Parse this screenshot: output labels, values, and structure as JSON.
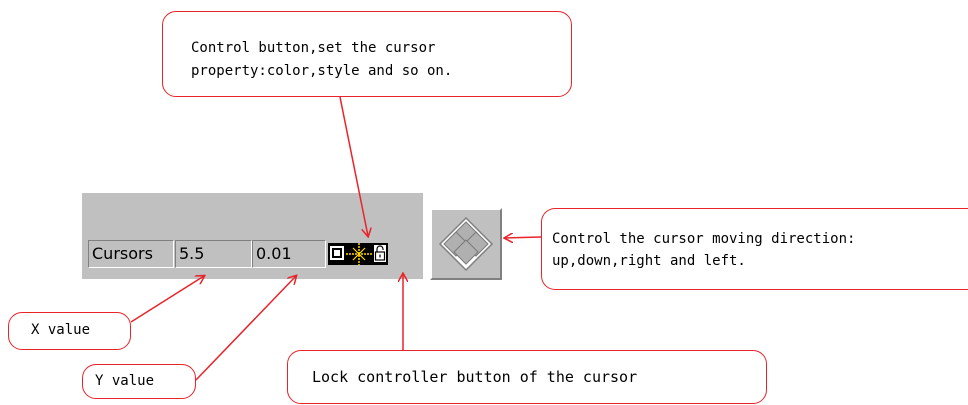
{
  "callouts": {
    "control_button": {
      "line1": "Control button,set the cursor",
      "line2": "property:color,style and so on."
    },
    "direction": {
      "line1": "Control the cursor moving direction:",
      "line2": "up,down,right and left."
    },
    "x_value": "X value",
    "y_value": "Y value",
    "lock": "Lock controller button of the cursor"
  },
  "panel": {
    "label": "Cursors",
    "x_value": "5.5",
    "y_value": "0.01"
  },
  "icons": {
    "style_button": "square-style-icon",
    "cursor_button": "crosshair-cursor-icon",
    "lock_button": "lock-icon",
    "direction_pad": "four-direction-diamond-icon"
  },
  "colors": {
    "accent": "#e8232a",
    "panel": "#c0c0c0",
    "crosshair": "#ffd700"
  }
}
